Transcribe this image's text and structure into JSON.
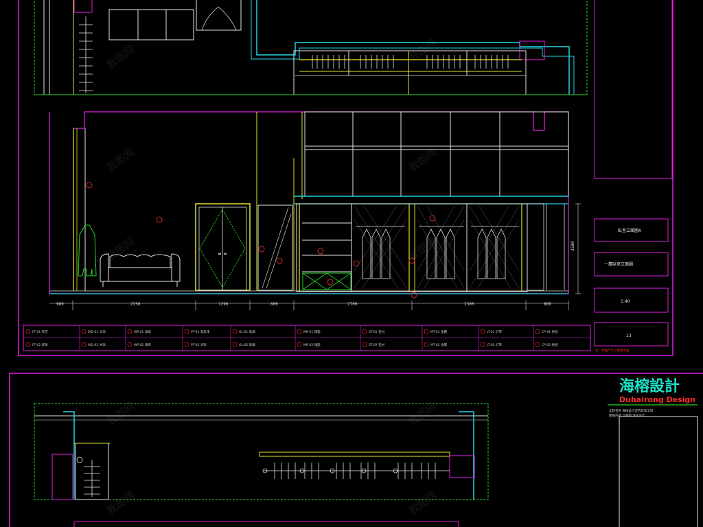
{
  "colors": {
    "magenta": "#e321e3",
    "cyan": "#22d8e6",
    "yellow": "#e6e62a",
    "green": "#29d829",
    "white": "#e6e6e6",
    "red": "#ff2e2e",
    "background": "#000000"
  },
  "title_block": {
    "field_1": "臥室立面圖A",
    "field_2": "一層臥室立面圖",
    "scale": "1:40",
    "sheet_no": "13"
  },
  "dimension_labels": [
    "960",
    "2350",
    "1290",
    "600",
    "2700",
    "2300",
    "860",
    "3580"
  ],
  "legend": {
    "items": [
      "FT-01 布艺",
      "WD-01 木饰",
      "WP-01 墙纸",
      "PT-01 乳胶漆",
      "GL-01 玻璃",
      "MR-01 镜面",
      "ST-01 石材",
      "MT-01 金属",
      "LT-01 灯带",
      "CP-01 地毯",
      "FT-02 皮革",
      "WD-02 木饰",
      "WP-02 墙布",
      "PT-02 涂料",
      "GL-02 玻璃",
      "MR-02 镜面",
      "ST-02 石材",
      "MT-02 金属",
      "LT-02 灯带",
      "CP-02 地毯"
    ],
    "note": "注：本图尺寸以现场为准"
  },
  "brand": {
    "chinese": "海榕設計",
    "english": "Duhairong Design",
    "note_line_1": "工程名称 海榕设计室内装饰工程",
    "note_line_2": "图纸内容 立面图 深化设计"
  },
  "watermark": "我图网"
}
